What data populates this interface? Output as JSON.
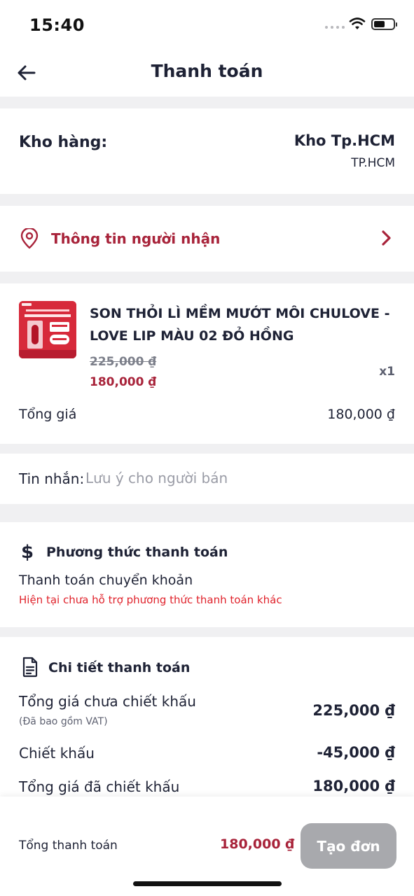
{
  "status_bar": {
    "time": "15:40"
  },
  "header": {
    "title": "Thanh toán"
  },
  "warehouse": {
    "label": "Kho hàng:",
    "name": "Kho Tp.HCM",
    "city": "TP.HCM"
  },
  "recipient": {
    "label": "Thông tin người nhận"
  },
  "product": {
    "name": "SON THỎI LÌ MỀM MƯỚT MÔI CHULOVE - LOVE LIP MÀU 02  ĐỎ HỒNG",
    "old_price": "225,000 ₫",
    "new_price": "180,000 ₫",
    "quantity": "x1",
    "total_label": "Tổng giá",
    "total_value": "180,000 ₫"
  },
  "message": {
    "label": "Tin nhắn:",
    "placeholder": "Lưu ý cho người bán"
  },
  "payment": {
    "heading": "Phương thức thanh toán",
    "method": "Thanh toán chuyển khoản",
    "note": "Hiện tại chưa hỗ trợ phương thức thanh toán khác"
  },
  "details": {
    "heading": "Chi tiết thanh toán",
    "rows": [
      {
        "label": "Tổng giá chưa chiết khấu",
        "sub": "(Đã bao gồm VAT)",
        "value": "225,000 ₫"
      },
      {
        "label": "Chiết khấu",
        "value": "-45,000 ₫"
      },
      {
        "label": "Tổng giá đã chiết khấu",
        "value": "180,000 ₫"
      }
    ]
  },
  "footer": {
    "total_label": "Tổng thanh toán",
    "total_value": "180,000 ₫",
    "submit_label": "Tạo đơn"
  },
  "colors": {
    "accent": "#a8233a",
    "warning": "#e0222b",
    "disabled_button": "#a8a9ad"
  }
}
